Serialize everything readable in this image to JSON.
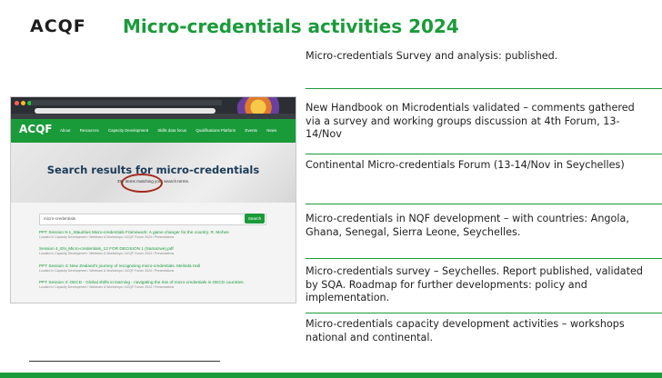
{
  "logo": "ACQF",
  "title": "Micro-credentials activities 2024",
  "activities": [
    {
      "lines": [
        "Micro-credentials Survey and analysis: published."
      ]
    },
    {
      "lines": [
        "New Handbook on Microdentials validated – comments gathered",
        "via a survey and working groups discussion at 4th Forum, 13-",
        "14/Nov"
      ]
    },
    {
      "lines": [
        "Continental Micro-credentials Forum (13-14/Nov in Seychelles)"
      ]
    },
    {
      "lines": [
        "Micro-credentials in NQF development – with countries: Angola,",
        "Ghana, Senegal, Sierra Leone, Seychelles."
      ]
    },
    {
      "lines": [
        "Micro-credentials survey – Seychelles. Report published, validated",
        "by SQA. Roadmap for further developments: policy and",
        "implementation."
      ]
    },
    {
      "lines": [
        "Micro-credentials capacity development activities – workshops",
        "national and continental."
      ]
    }
  ],
  "screenshot": {
    "site_logo": "ACQF",
    "nav": [
      "About",
      "Resources",
      "Capacity Development",
      "Skills data focus",
      "Qualifications Platform",
      "Events",
      "News"
    ],
    "hero_title": "Search results for micro-credentials",
    "hero_sub": "397 items matching your search terms.",
    "search_value": "micro-credentials",
    "search_button": "Search",
    "results": [
      {
        "title": "PPT Session 5-1_Mauritius Micro-credentials Framework: A game changer for the country. R. Mohee",
        "snippet": "Located in Capacity Development / Webinars & Workshops / ACQF Forum 2024 / Presentations"
      },
      {
        "title": "Session 4_EN_Micro-credentials_12 FOR DECISION 1 (Samazwe).pdf",
        "snippet": "Located in Capacity Development / Webinars & Workshops / ACQF Forum 2024 / Presentations"
      },
      {
        "title": "PPT Session 4: New Zealand's journey of recognising micro-credentials. Melinda Hall",
        "snippet": "Located in Capacity Development / Webinars & Workshops / ACQF Forum 2024 / Presentations"
      },
      {
        "title": "PPT Session 4: OECD - Global shifts in learning - navigating the rise of micro-credentials in OECD countries.",
        "snippet": "Located in Capacity Development / Webinars & Workshops / ACQF Forum 2024 / Presentations"
      }
    ]
  }
}
